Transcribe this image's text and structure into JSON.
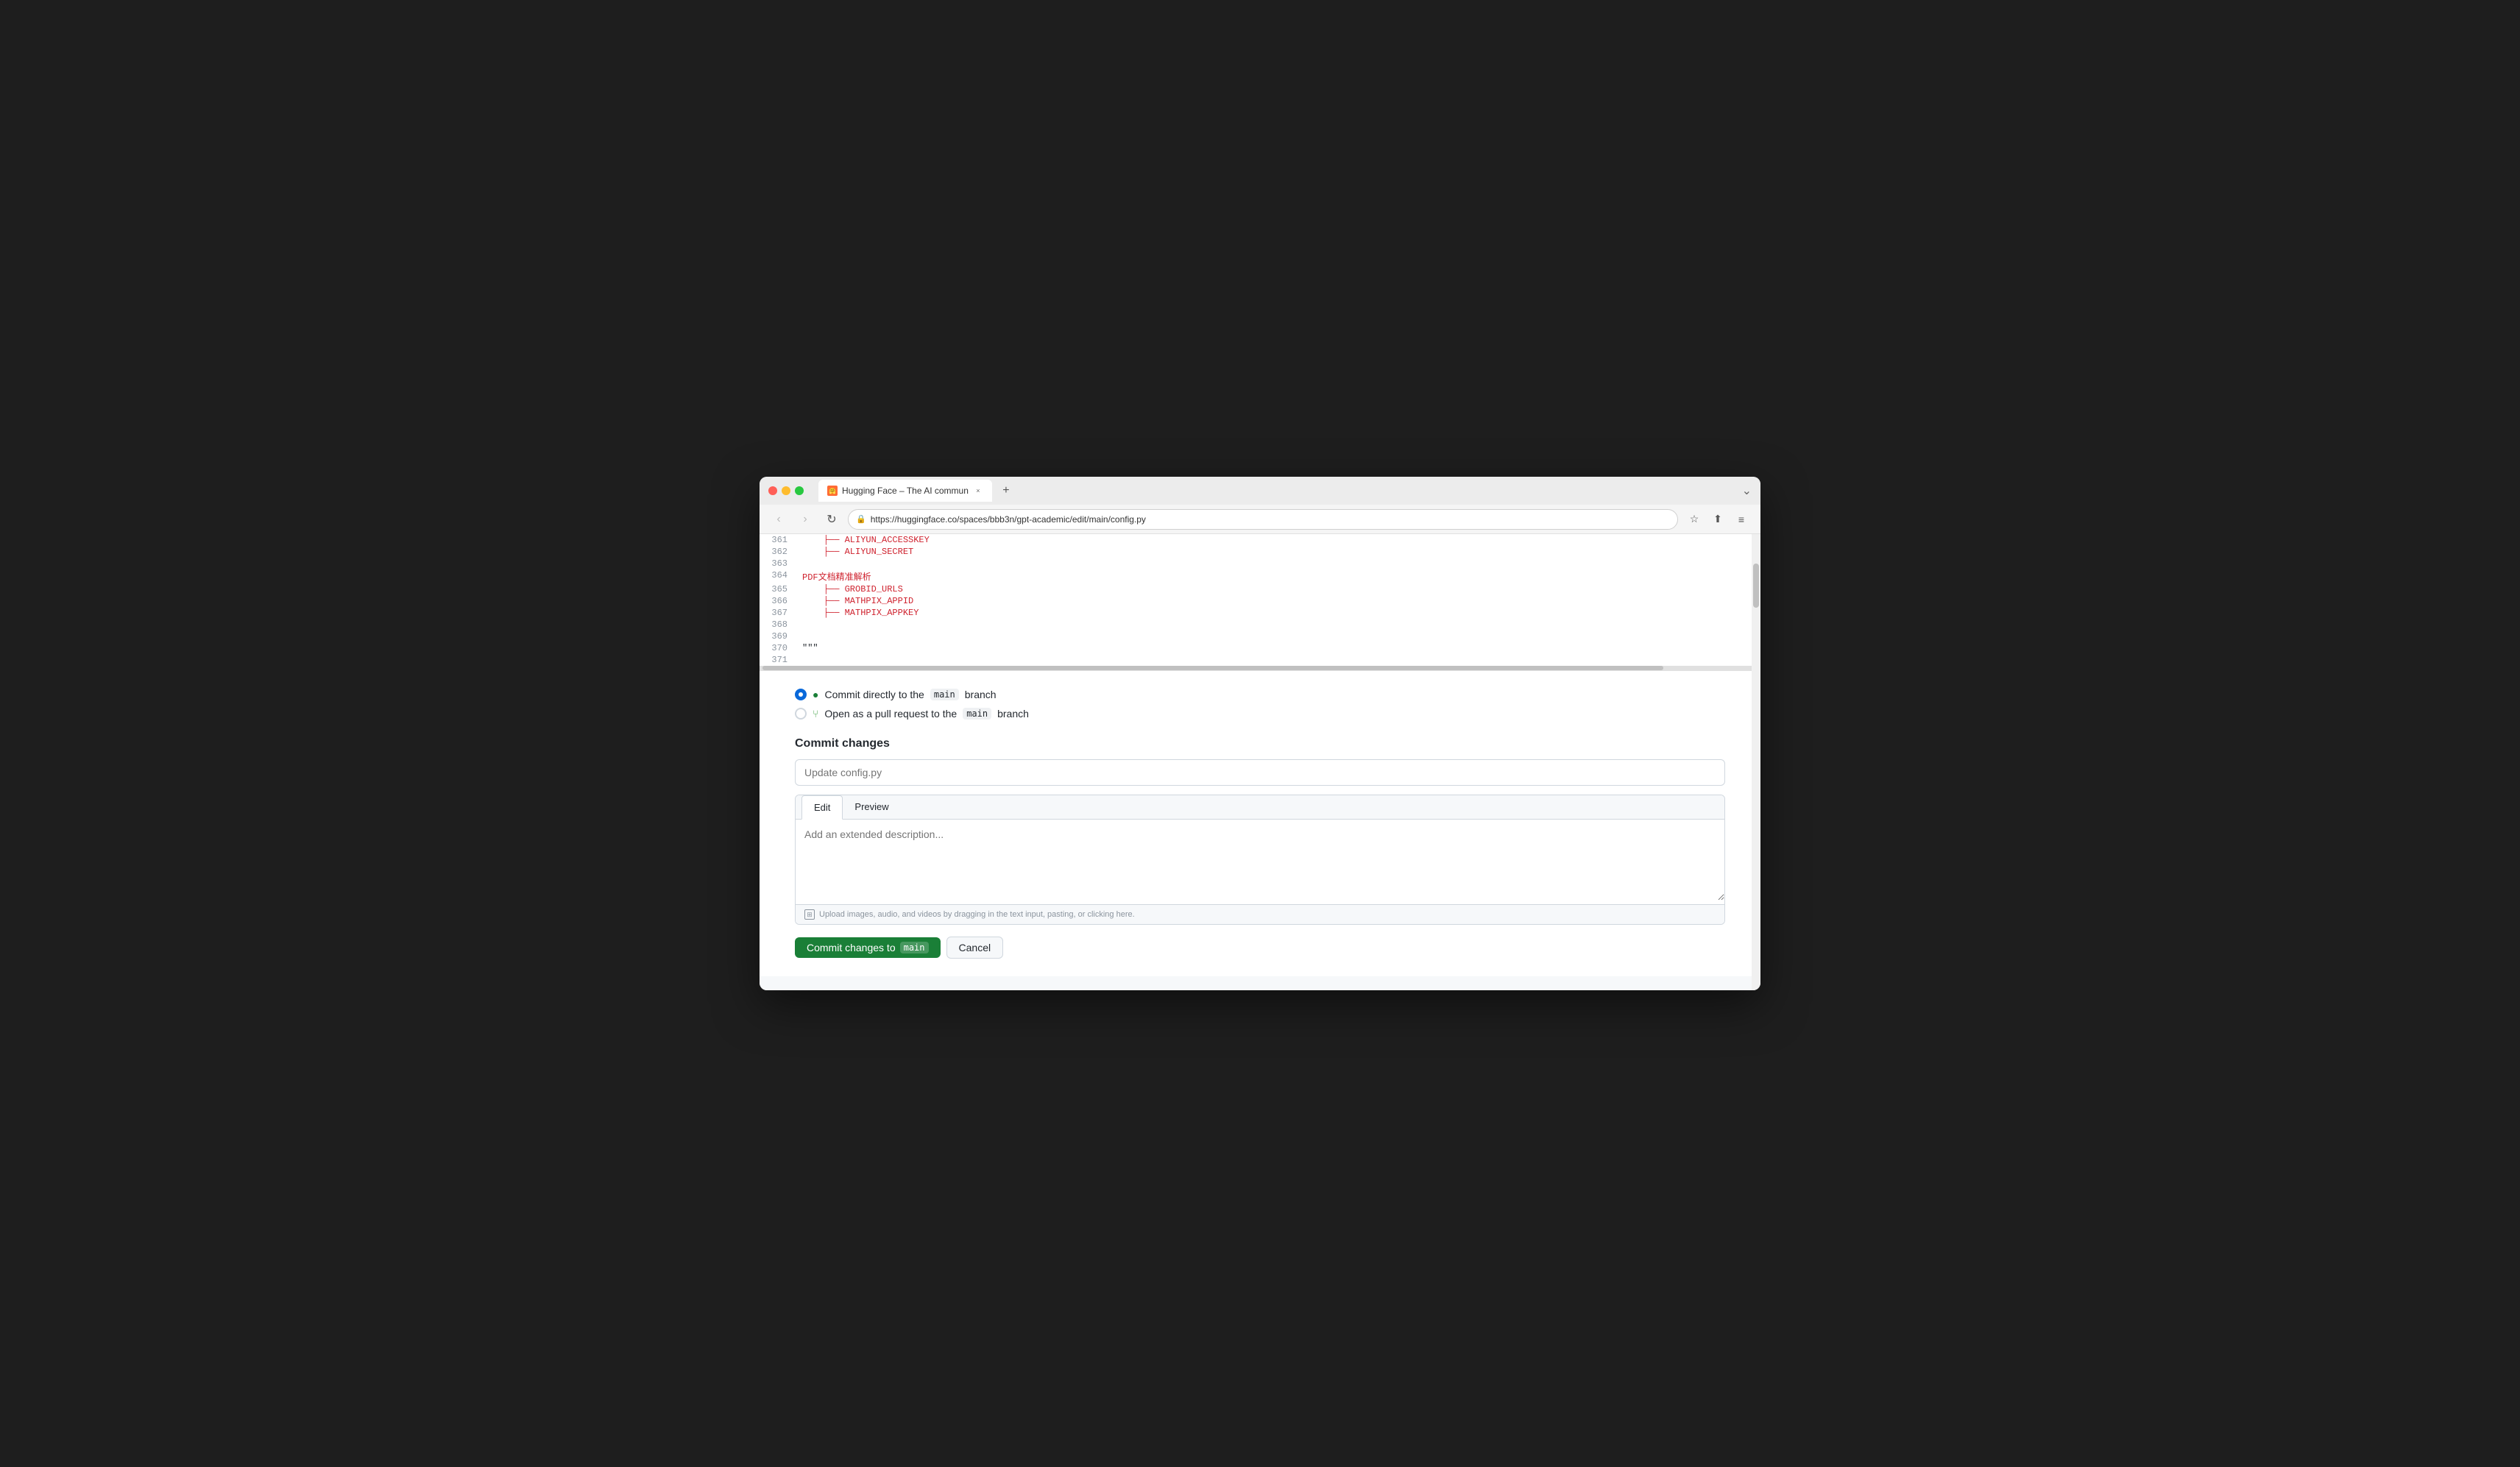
{
  "browser": {
    "tab_title": "Hugging Face – The AI commun",
    "tab_close": "×",
    "tab_new": "+",
    "url": "https://huggingface.co/spaces/bbb3n/gpt-academic/edit/main/config.py",
    "nav_back": "‹",
    "nav_forward": "›",
    "nav_refresh": "↻",
    "nav_chevron": "⌄"
  },
  "code": {
    "lines": [
      {
        "num": "361",
        "content": "    ALIYUN_ACCESSKEY",
        "indent": 2,
        "red": true
      },
      {
        "num": "362",
        "content": "    ALIYUN_SECRET",
        "indent": 2,
        "red": true
      },
      {
        "num": "363",
        "content": "",
        "indent": 0,
        "red": false
      },
      {
        "num": "364",
        "content": "PDF文档精准解析",
        "indent": 1,
        "red": true
      },
      {
        "num": "365",
        "content": "    GROBID_URLS",
        "indent": 2,
        "red": true
      },
      {
        "num": "366",
        "content": "    MATHPIX_APPID",
        "indent": 2,
        "red": true
      },
      {
        "num": "367",
        "content": "    MATHPIX_APPKEY",
        "indent": 2,
        "red": true
      },
      {
        "num": "368",
        "content": "",
        "indent": 0,
        "red": false
      },
      {
        "num": "369",
        "content": "",
        "indent": 0,
        "red": false
      },
      {
        "num": "370",
        "content": "\"\"\"",
        "indent": 0,
        "red": false
      },
      {
        "num": "371",
        "content": "",
        "indent": 0,
        "red": false
      }
    ]
  },
  "commit_options": {
    "direct_label": "Commit directly to the",
    "direct_branch": "main",
    "direct_suffix": "branch",
    "pr_label": "Open as a pull request to the",
    "pr_branch": "main",
    "pr_suffix": "branch"
  },
  "commit_form": {
    "section_title": "Commit changes",
    "summary_placeholder": "Update config.py",
    "tab_edit": "Edit",
    "tab_preview": "Preview",
    "description_placeholder": "Add an extended description...",
    "upload_hint": "Upload images, audio, and videos by dragging in the text input, pasting, or clicking here.",
    "btn_commit_label": "Commit changes to",
    "btn_commit_branch": "main",
    "btn_cancel_label": "Cancel"
  }
}
